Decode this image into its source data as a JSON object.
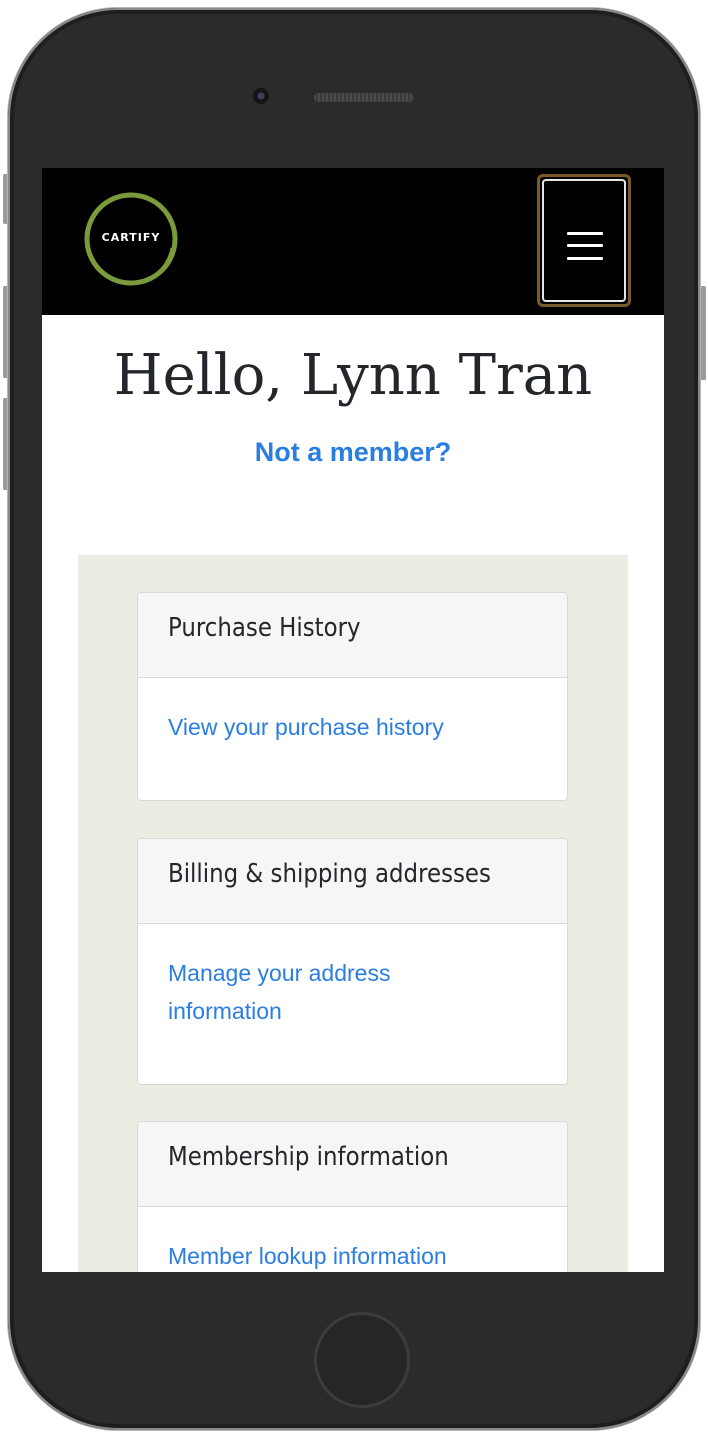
{
  "brand": {
    "logo_text": "CARTIFY",
    "accent": "#7b9a3c"
  },
  "header": {
    "greeting": "Hello, Lynn Tran",
    "not_member_link": "Not a member?"
  },
  "cards": [
    {
      "title": "Purchase History",
      "link": "View your purchase history"
    },
    {
      "title": "Billing & shipping addresses",
      "link": "Manage your address information"
    },
    {
      "title": "Membership information",
      "link": "Member lookup information"
    }
  ],
  "colors": {
    "link": "#2a7de1",
    "panel": "#ecece2",
    "navbar": "#000000",
    "menu_border": "#7a5a2a"
  }
}
